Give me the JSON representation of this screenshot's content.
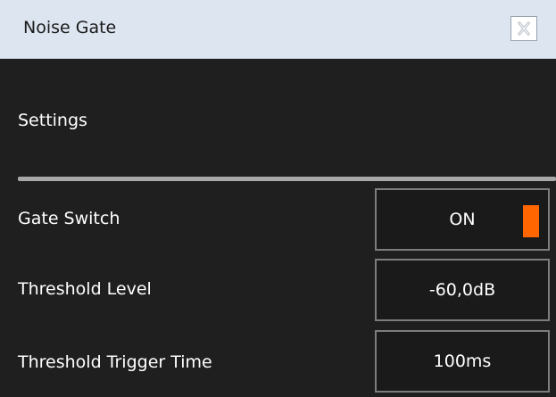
{
  "window": {
    "title": "Noise Gate",
    "close_label": "X"
  },
  "settings": {
    "section_title": "Settings",
    "rows": [
      {
        "label": "Gate Switch",
        "value": "ON",
        "indicator_color": "#ff6600"
      },
      {
        "label": "Threshold Level",
        "value": "-60,0dB"
      },
      {
        "label": "Threshold Trigger Time",
        "value": "100ms"
      }
    ]
  },
  "colors": {
    "background": "#1f1f1f",
    "titlebar": "#dde5f0",
    "accent": "#ff6600"
  }
}
